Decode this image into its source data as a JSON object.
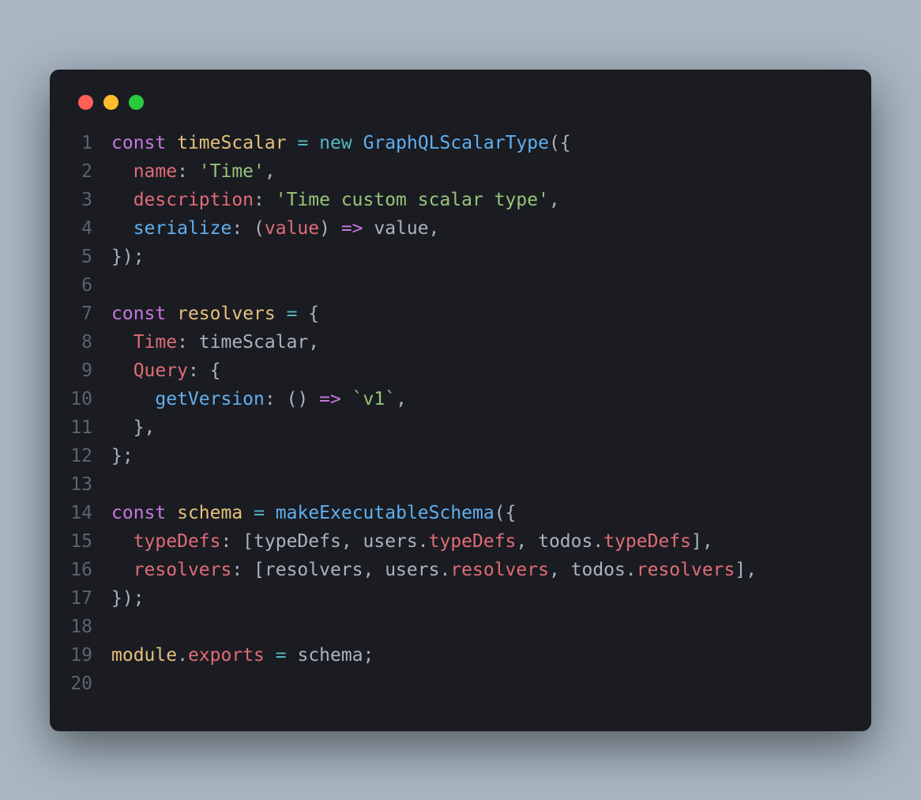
{
  "window": {
    "traffic_lights": {
      "red": "#ff5f56",
      "yellow": "#ffbd2e",
      "green": "#27c93f"
    }
  },
  "code": {
    "lines": [
      {
        "num": "1",
        "tokens": [
          {
            "t": "kw",
            "v": "const"
          },
          {
            "t": "punct",
            "v": " "
          },
          {
            "t": "var",
            "v": "timeScalar"
          },
          {
            "t": "punct",
            "v": " "
          },
          {
            "t": "op",
            "v": "="
          },
          {
            "t": "punct",
            "v": " "
          },
          {
            "t": "new",
            "v": "new"
          },
          {
            "t": "punct",
            "v": " "
          },
          {
            "t": "fn",
            "v": "GraphQLScalarType"
          },
          {
            "t": "punct",
            "v": "({"
          }
        ]
      },
      {
        "num": "2",
        "tokens": [
          {
            "t": "punct",
            "v": "  "
          },
          {
            "t": "prop",
            "v": "name"
          },
          {
            "t": "punct",
            "v": ": "
          },
          {
            "t": "str",
            "v": "'Time'"
          },
          {
            "t": "punct",
            "v": ","
          }
        ]
      },
      {
        "num": "3",
        "tokens": [
          {
            "t": "punct",
            "v": "  "
          },
          {
            "t": "prop",
            "v": "description"
          },
          {
            "t": "punct",
            "v": ": "
          },
          {
            "t": "str",
            "v": "'Time custom scalar type'"
          },
          {
            "t": "punct",
            "v": ","
          }
        ]
      },
      {
        "num": "4",
        "tokens": [
          {
            "t": "punct",
            "v": "  "
          },
          {
            "t": "fn",
            "v": "serialize"
          },
          {
            "t": "punct",
            "v": ": ("
          },
          {
            "t": "prop",
            "v": "value"
          },
          {
            "t": "punct",
            "v": ") "
          },
          {
            "t": "arrow",
            "v": "=>"
          },
          {
            "t": "punct",
            "v": " "
          },
          {
            "t": "param",
            "v": "value"
          },
          {
            "t": "punct",
            "v": ","
          }
        ]
      },
      {
        "num": "5",
        "tokens": [
          {
            "t": "punct",
            "v": "});"
          }
        ]
      },
      {
        "num": "6",
        "tokens": []
      },
      {
        "num": "7",
        "tokens": [
          {
            "t": "kw",
            "v": "const"
          },
          {
            "t": "punct",
            "v": " "
          },
          {
            "t": "var",
            "v": "resolvers"
          },
          {
            "t": "punct",
            "v": " "
          },
          {
            "t": "op",
            "v": "="
          },
          {
            "t": "punct",
            "v": " {"
          }
        ]
      },
      {
        "num": "8",
        "tokens": [
          {
            "t": "punct",
            "v": "  "
          },
          {
            "t": "prop",
            "v": "Time"
          },
          {
            "t": "punct",
            "v": ": "
          },
          {
            "t": "param",
            "v": "timeScalar"
          },
          {
            "t": "punct",
            "v": ","
          }
        ]
      },
      {
        "num": "9",
        "tokens": [
          {
            "t": "punct",
            "v": "  "
          },
          {
            "t": "prop",
            "v": "Query"
          },
          {
            "t": "punct",
            "v": ": {"
          }
        ]
      },
      {
        "num": "10",
        "tokens": [
          {
            "t": "punct",
            "v": "    "
          },
          {
            "t": "fn",
            "v": "getVersion"
          },
          {
            "t": "punct",
            "v": ": () "
          },
          {
            "t": "arrow",
            "v": "=>"
          },
          {
            "t": "punct",
            "v": " "
          },
          {
            "t": "str",
            "v": "`v1`"
          },
          {
            "t": "punct",
            "v": ","
          }
        ]
      },
      {
        "num": "11",
        "tokens": [
          {
            "t": "punct",
            "v": "  },"
          }
        ]
      },
      {
        "num": "12",
        "tokens": [
          {
            "t": "punct",
            "v": "};"
          }
        ]
      },
      {
        "num": "13",
        "tokens": []
      },
      {
        "num": "14",
        "tokens": [
          {
            "t": "kw",
            "v": "const"
          },
          {
            "t": "punct",
            "v": " "
          },
          {
            "t": "var",
            "v": "schema"
          },
          {
            "t": "punct",
            "v": " "
          },
          {
            "t": "op",
            "v": "="
          },
          {
            "t": "punct",
            "v": " "
          },
          {
            "t": "fn",
            "v": "makeExecutableSchema"
          },
          {
            "t": "punct",
            "v": "({"
          }
        ]
      },
      {
        "num": "15",
        "tokens": [
          {
            "t": "punct",
            "v": "  "
          },
          {
            "t": "prop",
            "v": "typeDefs"
          },
          {
            "t": "punct",
            "v": ": ["
          },
          {
            "t": "param",
            "v": "typeDefs"
          },
          {
            "t": "punct",
            "v": ", "
          },
          {
            "t": "param",
            "v": "users"
          },
          {
            "t": "punct",
            "v": "."
          },
          {
            "t": "prop",
            "v": "typeDefs"
          },
          {
            "t": "punct",
            "v": ", "
          },
          {
            "t": "param",
            "v": "todos"
          },
          {
            "t": "punct",
            "v": "."
          },
          {
            "t": "prop",
            "v": "typeDefs"
          },
          {
            "t": "punct",
            "v": "],"
          }
        ]
      },
      {
        "num": "16",
        "tokens": [
          {
            "t": "punct",
            "v": "  "
          },
          {
            "t": "prop",
            "v": "resolvers"
          },
          {
            "t": "punct",
            "v": ": ["
          },
          {
            "t": "param",
            "v": "resolvers"
          },
          {
            "t": "punct",
            "v": ", "
          },
          {
            "t": "param",
            "v": "users"
          },
          {
            "t": "punct",
            "v": "."
          },
          {
            "t": "prop",
            "v": "resolvers"
          },
          {
            "t": "punct",
            "v": ", "
          },
          {
            "t": "param",
            "v": "todos"
          },
          {
            "t": "punct",
            "v": "."
          },
          {
            "t": "prop",
            "v": "resolvers"
          },
          {
            "t": "punct",
            "v": "],"
          }
        ]
      },
      {
        "num": "17",
        "tokens": [
          {
            "t": "punct",
            "v": "});"
          }
        ]
      },
      {
        "num": "18",
        "tokens": []
      },
      {
        "num": "19",
        "tokens": [
          {
            "t": "obj",
            "v": "module"
          },
          {
            "t": "punct",
            "v": "."
          },
          {
            "t": "prop",
            "v": "exports"
          },
          {
            "t": "punct",
            "v": " "
          },
          {
            "t": "op",
            "v": "="
          },
          {
            "t": "punct",
            "v": " "
          },
          {
            "t": "param",
            "v": "schema"
          },
          {
            "t": "punct",
            "v": ";"
          }
        ]
      },
      {
        "num": "20",
        "tokens": []
      }
    ]
  }
}
